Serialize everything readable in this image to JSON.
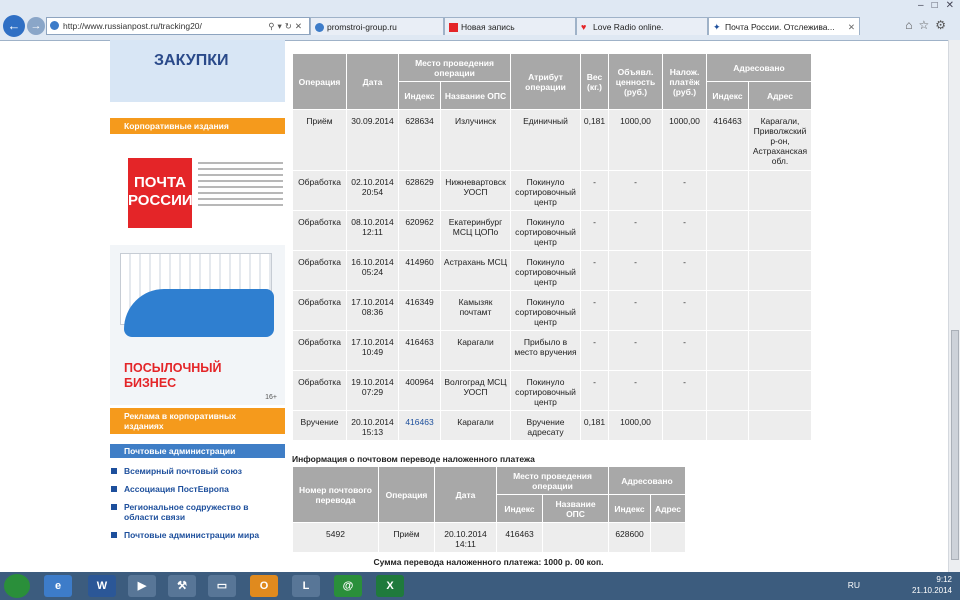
{
  "browser": {
    "url": "http://www.russianpost.ru/tracking20/",
    "window_controls": [
      "–",
      "□",
      "✕"
    ],
    "tabs": [
      {
        "label": "promstroi-group.ru"
      },
      {
        "label": "Новая запись"
      },
      {
        "label": "Love Radio online."
      },
      {
        "label": "Почта России. Отслежива..."
      }
    ]
  },
  "sidebar": {
    "map_title": "ЗАКУПКИ",
    "corporate_editions": "Корпоративные издания",
    "magazine_logo": "ПОЧТА РОССИИ",
    "parcel_business": "ПОСЫЛОЧНЫЙ БИЗНЕС",
    "age_mark": "16+",
    "advertising": "Реклама в корпоративных изданиях",
    "postal_admin_header": "Почтовые администрации",
    "links": [
      "Всемирный почтовый союз",
      "Ассоциация ПостЕвропа",
      "Региональное содружество в области связи",
      "Почтовые администрации мира"
    ]
  },
  "tracking": {
    "headers": {
      "operation": "Операция",
      "date": "Дата",
      "place": "Место проведения операции",
      "index": "Индекс",
      "ops_name": "Название ОПС",
      "attribute": "Атрибут операции",
      "weight": "Вес (кг.)",
      "declared_value": "Объявл. ценность (руб.)",
      "cod": "Налож. платёж (руб.)",
      "addressed": "Адресовано",
      "addr_index": "Индекс",
      "address": "Адрес"
    },
    "rows": [
      {
        "op": "Приём",
        "date": "30.09.2014",
        "index": "628634",
        "name": "Излучинск",
        "attr": "Единичный",
        "weight": "0,181",
        "value": "1000,00",
        "cod": "1000,00",
        "addr_index": "416463",
        "address": "Карагали, Приволжский р-он, Астраханская обл."
      },
      {
        "op": "Обработка",
        "date": "02.10.2014 20:54",
        "index": "628629",
        "name": "Нижневартовск УОСП",
        "attr": "Покинуло сортировочный центр",
        "weight": "-",
        "value": "-",
        "cod": "-",
        "addr_index": "",
        "address": ""
      },
      {
        "op": "Обработка",
        "date": "08.10.2014 12:11",
        "index": "620962",
        "name": "Екатеринбург МСЦ ЦОПо",
        "attr": "Покинуло сортировочный центр",
        "weight": "-",
        "value": "-",
        "cod": "-",
        "addr_index": "",
        "address": ""
      },
      {
        "op": "Обработка",
        "date": "16.10.2014 05:24",
        "index": "414960",
        "name": "Астрахань МСЦ",
        "attr": "Покинуло сортировочный центр",
        "weight": "-",
        "value": "-",
        "cod": "-",
        "addr_index": "",
        "address": ""
      },
      {
        "op": "Обработка",
        "date": "17.10.2014 08:36",
        "index": "416349",
        "name": "Камызяк почтамт",
        "attr": "Покинуло сортировочный центр",
        "weight": "-",
        "value": "-",
        "cod": "-",
        "addr_index": "",
        "address": ""
      },
      {
        "op": "Обработка",
        "date": "17.10.2014 10:49",
        "index": "416463",
        "name": "Карагали",
        "attr": "Прибыло в место вручения",
        "weight": "-",
        "value": "-",
        "cod": "-",
        "addr_index": "",
        "address": ""
      },
      {
        "op": "Обработка",
        "date": "19.10.2014 07:29",
        "index": "400964",
        "name": "Волгоград МСЦ УОСП",
        "attr": "Покинуло сортировочный центр",
        "weight": "-",
        "value": "-",
        "cod": "-",
        "addr_index": "",
        "address": ""
      },
      {
        "op": "Вручение",
        "date": "20.10.2014 15:13",
        "index": "416463",
        "name": "Карагали",
        "attr": "Вручение адресату",
        "weight": "0,181",
        "value": "1000,00",
        "cod": "",
        "addr_index": "",
        "address": ""
      }
    ]
  },
  "transfer": {
    "title": "Информация о почтовом переводе наложенного платежа",
    "headers": {
      "number": "Номер почтового перевода",
      "operation": "Операция",
      "date": "Дата",
      "place": "Место проведения операции",
      "index": "Индекс",
      "ops_name": "Название ОПС",
      "addressed": "Адресовано",
      "addr_index": "Индекс",
      "address": "Адрес"
    },
    "row": {
      "number": "5492",
      "op": "Приём",
      "date": "20.10.2014 14:11",
      "index": "416463",
      "name": "",
      "addr_index": "628600",
      "address": ""
    },
    "sum": "Сумма перевода наложенного платежа: 1000 р. 00 коп."
  },
  "taskbar": {
    "lang": "RU",
    "time": "9:12",
    "date": "21.10.2014"
  },
  "colors": {
    "header_gray": "#a8a8a8",
    "cell_gray": "#ededed",
    "orange": "#f59a1c",
    "blue": "#3f7ec6",
    "post_red": "#e42528"
  }
}
